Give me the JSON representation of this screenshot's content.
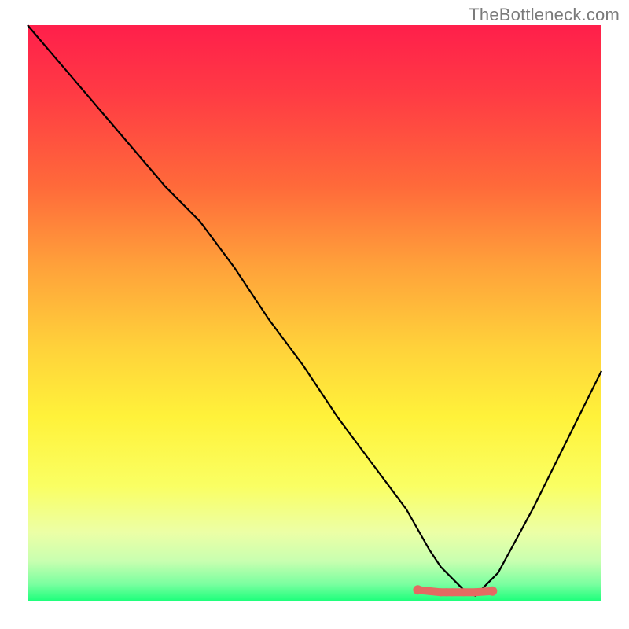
{
  "watermark": "TheBottleneck.com",
  "colors": {
    "line": "#000000",
    "marker": "#e46a62",
    "gradient_stops": [
      [
        "0%",
        "#ff1f4b"
      ],
      [
        "12%",
        "#ff3b44"
      ],
      [
        "28%",
        "#ff6a3a"
      ],
      [
        "42%",
        "#ffa23a"
      ],
      [
        "56%",
        "#ffd23a"
      ],
      [
        "68%",
        "#fff23a"
      ],
      [
        "80%",
        "#faff63"
      ],
      [
        "88%",
        "#ecffa6"
      ],
      [
        "93%",
        "#c8ffb0"
      ],
      [
        "97%",
        "#7affa0"
      ],
      [
        "100%",
        "#1aff7a"
      ]
    ]
  },
  "chart_data": {
    "type": "line",
    "title": "",
    "xlabel": "",
    "ylabel": "",
    "xlim": [
      0,
      100
    ],
    "ylim": [
      0,
      100
    ],
    "series": [
      {
        "name": "bottleneck-curve",
        "x": [
          0,
          6,
          12,
          18,
          24,
          26,
          30,
          36,
          42,
          48,
          54,
          60,
          66,
          70,
          72,
          76,
          78,
          82,
          88,
          94,
          100
        ],
        "y": [
          100,
          93,
          86,
          79,
          72,
          70,
          66,
          58,
          49,
          41,
          32,
          24,
          16,
          9,
          6,
          2,
          1,
          5,
          16,
          28,
          40
        ]
      }
    ],
    "markers": {
      "name": "target-range",
      "x": [
        68,
        70,
        72,
        73,
        74,
        76,
        78,
        81
      ],
      "y": [
        2.0,
        1.8,
        1.6,
        1.6,
        1.6,
        1.6,
        1.6,
        1.8
      ]
    }
  }
}
